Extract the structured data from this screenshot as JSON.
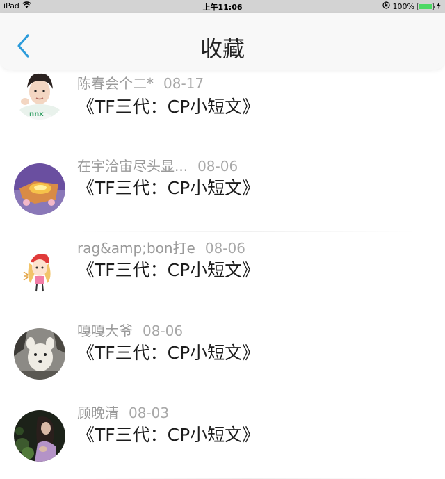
{
  "status_bar": {
    "device": "iPad",
    "time": "上午11:06",
    "battery": "100%",
    "battery_level": 1.0
  },
  "nav": {
    "title": "收藏"
  },
  "items": [
    {
      "user": "陈春会个二*",
      "date": "08-17",
      "content": "《TF三代：CP小短文》"
    },
    {
      "user": "在宇洽宙尽头显...",
      "date": "08-06",
      "content": "《TF三代：CP小短文》"
    },
    {
      "user": "rag&amp;bon打e",
      "date": "08-06",
      "content": "《TF三代：CP小短文》"
    },
    {
      "user": "嘎嘎大爷",
      "date": "08-06",
      "content": "《TF三代：CP小短文》"
    },
    {
      "user": "顾晚清",
      "date": "08-03",
      "content": "《TF三代：CP小短文》"
    }
  ],
  "colors": {
    "accent": "#2d9cdb",
    "battery": "#4cd964"
  }
}
